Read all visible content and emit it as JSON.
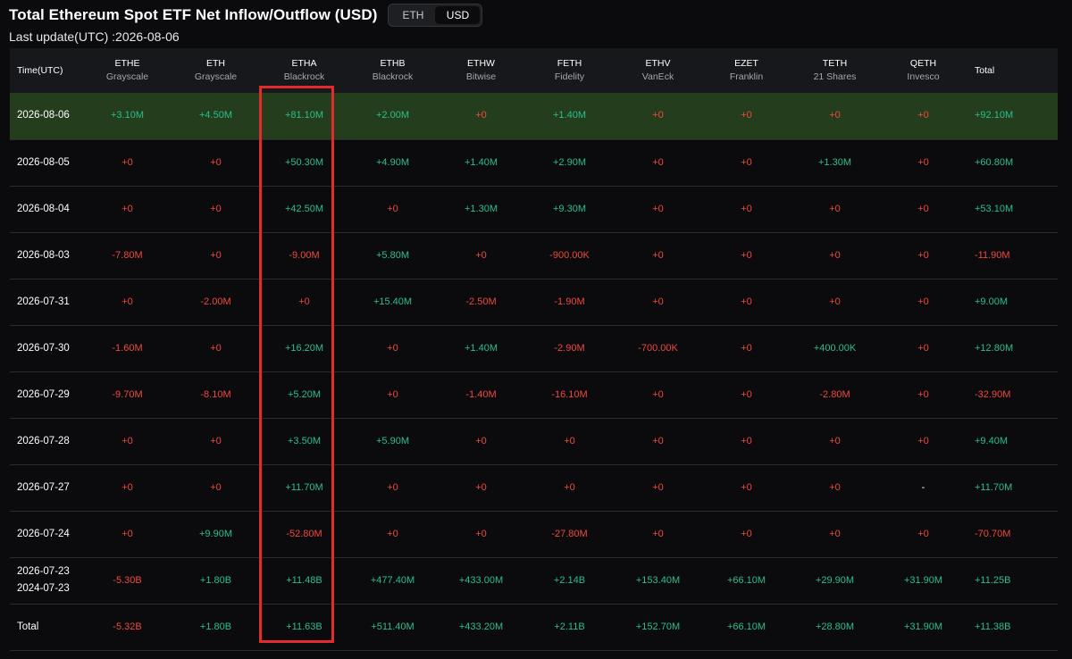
{
  "header": {
    "title": "Total Ethereum Spot ETF Net Inflow/Outflow (USD)",
    "toggle": [
      "ETH",
      "USD"
    ],
    "toggle_active": "USD",
    "last_update": "Last update(UTC) :2026-08-06"
  },
  "colors": {
    "positive": "#2bbf8d",
    "negative": "#f0483e",
    "highlight_row": "#243d1c",
    "annotation_box": "#e22b2b"
  },
  "table": {
    "time_header": "Time(UTC)",
    "total_header": "Total",
    "columns": [
      {
        "ticker": "ETHE",
        "issuer": "Grayscale"
      },
      {
        "ticker": "ETH",
        "issuer": "Grayscale"
      },
      {
        "ticker": "ETHA",
        "issuer": "Blackrock"
      },
      {
        "ticker": "ETHB",
        "issuer": "Blackrock"
      },
      {
        "ticker": "ETHW",
        "issuer": "Bitwise"
      },
      {
        "ticker": "FETH",
        "issuer": "Fidelity"
      },
      {
        "ticker": "ETHV",
        "issuer": "VanEck"
      },
      {
        "ticker": "EZET",
        "issuer": "Franklin"
      },
      {
        "ticker": "TETH",
        "issuer": "21 Shares"
      },
      {
        "ticker": "QETH",
        "issuer": "Invesco"
      }
    ],
    "rows": [
      {
        "date": [
          "2026-08-06"
        ],
        "values": [
          "+3.10M",
          "+4.50M",
          "+81.10M",
          "+2.00M",
          "+0",
          "+1.40M",
          "+0",
          "+0",
          "+0",
          "+0"
        ],
        "total": "+92.10M",
        "highlight": true
      },
      {
        "date": [
          "2026-08-05"
        ],
        "values": [
          "+0",
          "+0",
          "+50.30M",
          "+4.90M",
          "+1.40M",
          "+2.90M",
          "+0",
          "+0",
          "+1.30M",
          "+0"
        ],
        "total": "+60.80M"
      },
      {
        "date": [
          "2026-08-04"
        ],
        "values": [
          "+0",
          "+0",
          "+42.50M",
          "+0",
          "+1.30M",
          "+9.30M",
          "+0",
          "+0",
          "+0",
          "+0"
        ],
        "total": "+53.10M"
      },
      {
        "date": [
          "2026-08-03"
        ],
        "values": [
          "-7.80M",
          "+0",
          "-9.00M",
          "+5.80M",
          "+0",
          "-900.00K",
          "+0",
          "+0",
          "+0",
          "+0"
        ],
        "total": "-11.90M"
      },
      {
        "date": [
          "2026-07-31"
        ],
        "values": [
          "+0",
          "-2.00M",
          "+0",
          "+15.40M",
          "-2.50M",
          "-1.90M",
          "+0",
          "+0",
          "+0",
          "+0"
        ],
        "total": "+9.00M"
      },
      {
        "date": [
          "2026-07-30"
        ],
        "values": [
          "-1.60M",
          "+0",
          "+16.20M",
          "+0",
          "+1.40M",
          "-2.90M",
          "-700.00K",
          "+0",
          "+400.00K",
          "+0"
        ],
        "total": "+12.80M"
      },
      {
        "date": [
          "2026-07-29"
        ],
        "values": [
          "-9.70M",
          "-8.10M",
          "+5.20M",
          "+0",
          "-1.40M",
          "-16.10M",
          "+0",
          "+0",
          "-2.80M",
          "+0"
        ],
        "total": "-32.90M"
      },
      {
        "date": [
          "2026-07-28"
        ],
        "values": [
          "+0",
          "+0",
          "+3.50M",
          "+5.90M",
          "+0",
          "+0",
          "+0",
          "+0",
          "+0",
          "+0"
        ],
        "total": "+9.40M"
      },
      {
        "date": [
          "2026-07-27"
        ],
        "values": [
          "+0",
          "+0",
          "+11.70M",
          "+0",
          "+0",
          "+0",
          "+0",
          "+0",
          "+0",
          "-"
        ],
        "total": "+11.70M"
      },
      {
        "date": [
          "2026-07-24"
        ],
        "values": [
          "+0",
          "+9.90M",
          "-52.80M",
          "+0",
          "+0",
          "-27.80M",
          "+0",
          "+0",
          "+0",
          "+0"
        ],
        "total": "-70.70M"
      },
      {
        "date": [
          "2026-07-23",
          "2024-07-23"
        ],
        "values": [
          "-5.30B",
          "+1.80B",
          "+11.48B",
          "+477.40M",
          "+433.00M",
          "+2.14B",
          "+153.40M",
          "+66.10M",
          "+29.90M",
          "+31.90M"
        ],
        "total": "+11.25B"
      },
      {
        "date": [
          "Total"
        ],
        "values": [
          "-5.32B",
          "+1.80B",
          "+11.63B",
          "+511.40M",
          "+433.20M",
          "+2.11B",
          "+152.70M",
          "+66.10M",
          "+28.80M",
          "+31.90M"
        ],
        "total": "+11.38B"
      }
    ]
  }
}
